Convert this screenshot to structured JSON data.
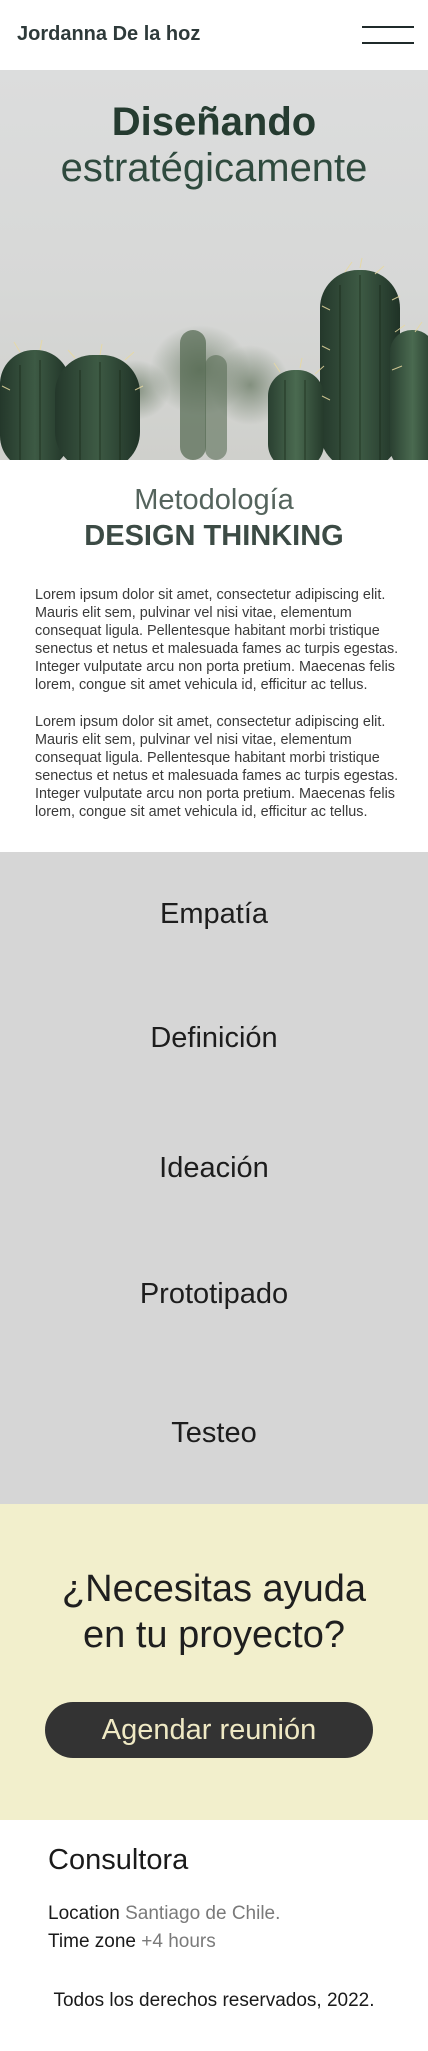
{
  "header": {
    "brand": "Jordanna De la hoz",
    "menu_icon": "hamburger-menu-icon"
  },
  "hero": {
    "title_bold": "Diseñando",
    "title_light": "estratégicamente",
    "image": "cactus-photo"
  },
  "methodology": {
    "subtitle": "Metodología",
    "title": "DESIGN THINKING",
    "paragraphs": [
      "Lorem ipsum dolor sit amet, consectetur adipiscing elit. Mauris elit sem, pulvinar vel nisi vitae, elementum consequat ligula. Pellentesque habitant morbi tristique senectus et netus et malesuada fames ac turpis egestas. Integer vulputate arcu non porta pretium. Maecenas felis lorem, congue sit amet vehicula id, efficitur ac tellus.",
      "Lorem ipsum dolor sit amet, consectetur adipiscing elit. Mauris elit sem, pulvinar vel nisi vitae, elementum consequat ligula. Pellentesque habitant morbi tristique senectus et netus et malesuada fames ac turpis egestas. Integer vulputate arcu non porta pretium. Maecenas felis lorem, congue sit amet vehicula id, efficitur ac tellus."
    ]
  },
  "steps": [
    "Empatía",
    "Definición",
    "Ideación",
    "Prototipado",
    "Testeo"
  ],
  "cta": {
    "line1": "¿Necesitas ayuda",
    "line2": "en tu proyecto?",
    "button": "Agendar reunión"
  },
  "footer": {
    "title": "Consultora",
    "location_label": "Location",
    "location_value": "Santiago de Chile.",
    "timezone_label": "Time zone",
    "timezone_value": "+4 hours",
    "copyright": "Todos los derechos reservados, 2022."
  },
  "colors": {
    "hero_bg": "#d9dad9",
    "steps_bg": "#d6d6d6",
    "cta_bg": "#f2efcc",
    "button_bg": "#333333",
    "accent_green": "#253b30"
  }
}
